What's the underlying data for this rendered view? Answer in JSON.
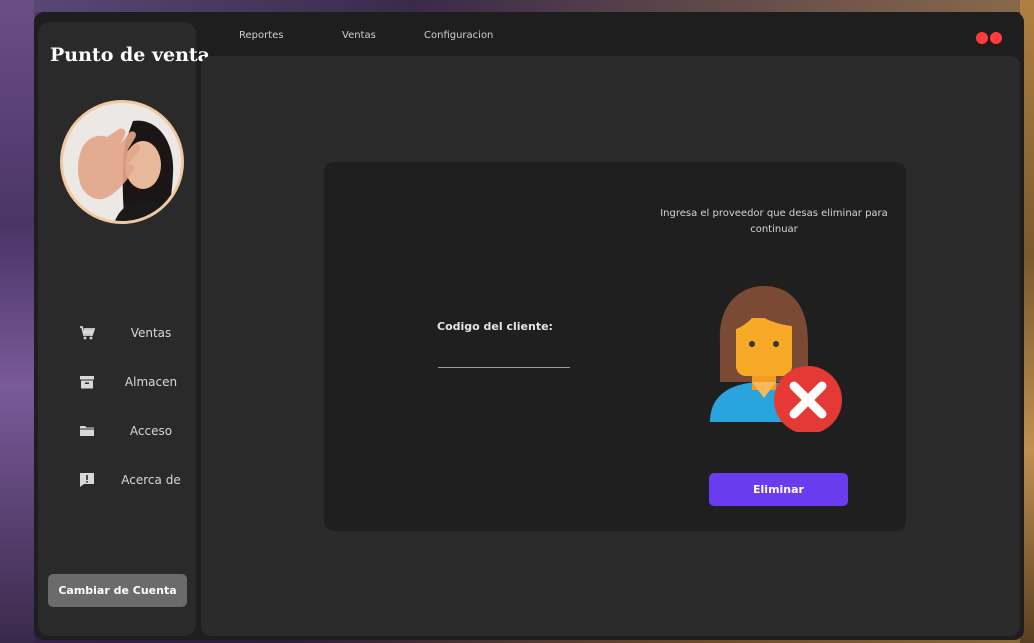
{
  "app": {
    "title": "Punto de venta"
  },
  "top_menu": {
    "items": [
      "Reportes",
      "Ventas",
      "Configuracion"
    ]
  },
  "sidebar": {
    "items": [
      {
        "label": "Ventas",
        "icon": "cart-icon"
      },
      {
        "label": "Almacen",
        "icon": "archive-icon"
      },
      {
        "label": "Acceso",
        "icon": "folder-icon"
      },
      {
        "label": "Acerca de",
        "icon": "alert-message-icon"
      }
    ],
    "switch_account_label": "Cambiar de Cuenta"
  },
  "form": {
    "instruction": "Ingresa el proveedor que desas eliminar para continuar",
    "field_label": "Codigo del cliente:",
    "field_value": "",
    "delete_label": "Eliminar"
  },
  "colors": {
    "accent": "#6a3cf0",
    "window_controls": "#ff3b3b",
    "avatar_ring": "#f0c9a0"
  }
}
